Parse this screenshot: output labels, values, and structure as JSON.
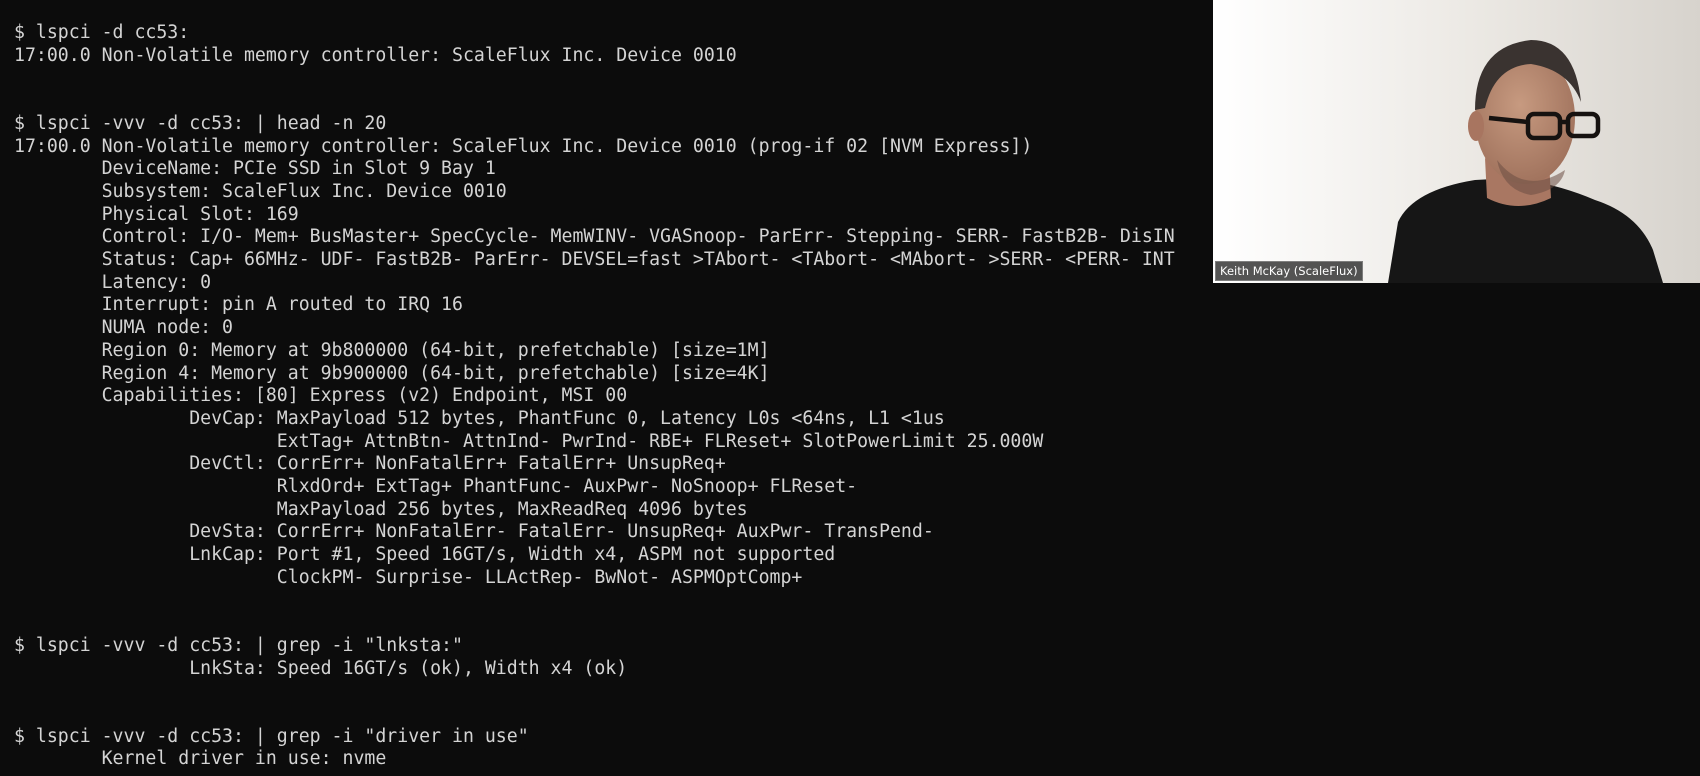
{
  "terminal": {
    "lines": [
      "$ lspci -d cc53:",
      "17:00.0 Non-Volatile memory controller: ScaleFlux Inc. Device 0010",
      "",
      "",
      "$ lspci -vvv -d cc53: | head -n 20",
      "17:00.0 Non-Volatile memory controller: ScaleFlux Inc. Device 0010 (prog-if 02 [NVM Express])",
      "        DeviceName: PCIe SSD in Slot 9 Bay 1",
      "        Subsystem: ScaleFlux Inc. Device 0010",
      "        Physical Slot: 169",
      "        Control: I/O- Mem+ BusMaster+ SpecCycle- MemWINV- VGASnoop- ParErr- Stepping- SERR- FastB2B- DisIN",
      "        Status: Cap+ 66MHz- UDF- FastB2B- ParErr- DEVSEL=fast >TAbort- <TAbort- <MAbort- >SERR- <PERR- INT",
      "        Latency: 0",
      "        Interrupt: pin A routed to IRQ 16",
      "        NUMA node: 0",
      "        Region 0: Memory at 9b800000 (64-bit, prefetchable) [size=1M]",
      "        Region 4: Memory at 9b900000 (64-bit, prefetchable) [size=4K]",
      "        Capabilities: [80] Express (v2) Endpoint, MSI 00",
      "                DevCap: MaxPayload 512 bytes, PhantFunc 0, Latency L0s <64ns, L1 <1us",
      "                        ExtTag+ AttnBtn- AttnInd- PwrInd- RBE+ FLReset+ SlotPowerLimit 25.000W",
      "                DevCtl: CorrErr+ NonFatalErr+ FatalErr+ UnsupReq+",
      "                        RlxdOrd+ ExtTag+ PhantFunc- AuxPwr- NoSnoop+ FLReset-",
      "                        MaxPayload 256 bytes, MaxReadReq 4096 bytes",
      "                DevSta: CorrErr+ NonFatalErr- FatalErr- UnsupReq+ AuxPwr- TransPend-",
      "                LnkCap: Port #1, Speed 16GT/s, Width x4, ASPM not supported",
      "                        ClockPM- Surprise- LLActRep- BwNot- ASPMOptComp+",
      "",
      "",
      "$ lspci -vvv -d cc53: | grep -i \"lnksta:\"",
      "                LnkSta: Speed 16GT/s (ok), Width x4 (ok)",
      "",
      "",
      "$ lspci -vvv -d cc53: | grep -i \"driver in use\"",
      "        Kernel driver in use: nvme"
    ]
  },
  "video": {
    "participant_name": "Keith McKay (ScaleFlux)"
  },
  "colors": {
    "terminal_bg": "#0c0c0c",
    "terminal_fg": "#d4d4d4",
    "wall": "#e3e0db",
    "shirt": "#161616"
  }
}
